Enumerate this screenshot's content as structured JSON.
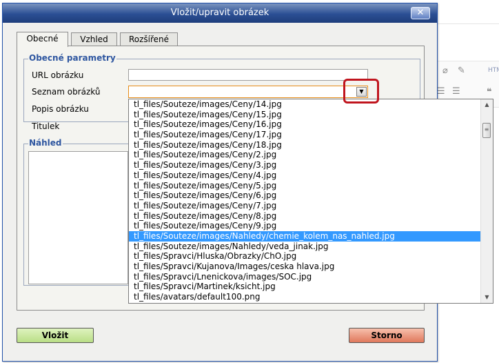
{
  "dialog": {
    "title": "Vložit/upravit obrázek",
    "close_glyph": "✕"
  },
  "tabs": [
    {
      "label": "Obecné",
      "active": true
    },
    {
      "label": "Vzhled",
      "active": false
    },
    {
      "label": "Rozšířené",
      "active": false
    }
  ],
  "general": {
    "legend": "Obecné parametry",
    "url_label": "URL obrázku",
    "list_label": "Seznam obrázků",
    "desc_label": "Popis obrázku",
    "title_label": "Titulek",
    "url_value": "",
    "desc_value": "",
    "title_value": ""
  },
  "preview": {
    "legend": "Náhled"
  },
  "image_list": {
    "selected_index": 13,
    "options": [
      "tl_files/Souteze/images/Ceny/14.jpg",
      "tl_files/Souteze/images/Ceny/15.jpg",
      "tl_files/Souteze/images/Ceny/16.jpg",
      "tl_files/Souteze/images/Ceny/17.jpg",
      "tl_files/Souteze/images/Ceny/18.jpg",
      "tl_files/Souteze/images/Ceny/2.jpg",
      "tl_files/Souteze/images/Ceny/3.jpg",
      "tl_files/Souteze/images/Ceny/4.jpg",
      "tl_files/Souteze/images/Ceny/5.jpg",
      "tl_files/Souteze/images/Ceny/6.jpg",
      "tl_files/Souteze/images/Ceny/7.jpg",
      "tl_files/Souteze/images/Ceny/8.jpg",
      "tl_files/Souteze/images/Ceny/9.jpg",
      "tl_files/Souteze/images/Nahledy/chemie_kolem_nas_nahled.jpg",
      "tl_files/Souteze/images/Nahledy/veda_jinak.jpg",
      "tl_files/Spravci/Hluska/Obrazky/ChO.jpg",
      "tl_files/Spravci/Kujanova/Images/ceska hlava.jpg",
      "tl_files/Spravci/Lnenickova/images/SOC.jpg",
      "tl_files/Spravci/Martinek/ksicht.jpg",
      "tl_files/avatars/default100.png"
    ]
  },
  "buttons": {
    "insert": "Vložit",
    "cancel": "Storno"
  },
  "background_editor": {
    "html_label": "HTML"
  },
  "colors": {
    "accent": "#2e56a0",
    "selection": "#3399ff",
    "highlight": "#c0151e",
    "insert_btn": "#b9de86",
    "cancel_btn": "#e0785c"
  }
}
